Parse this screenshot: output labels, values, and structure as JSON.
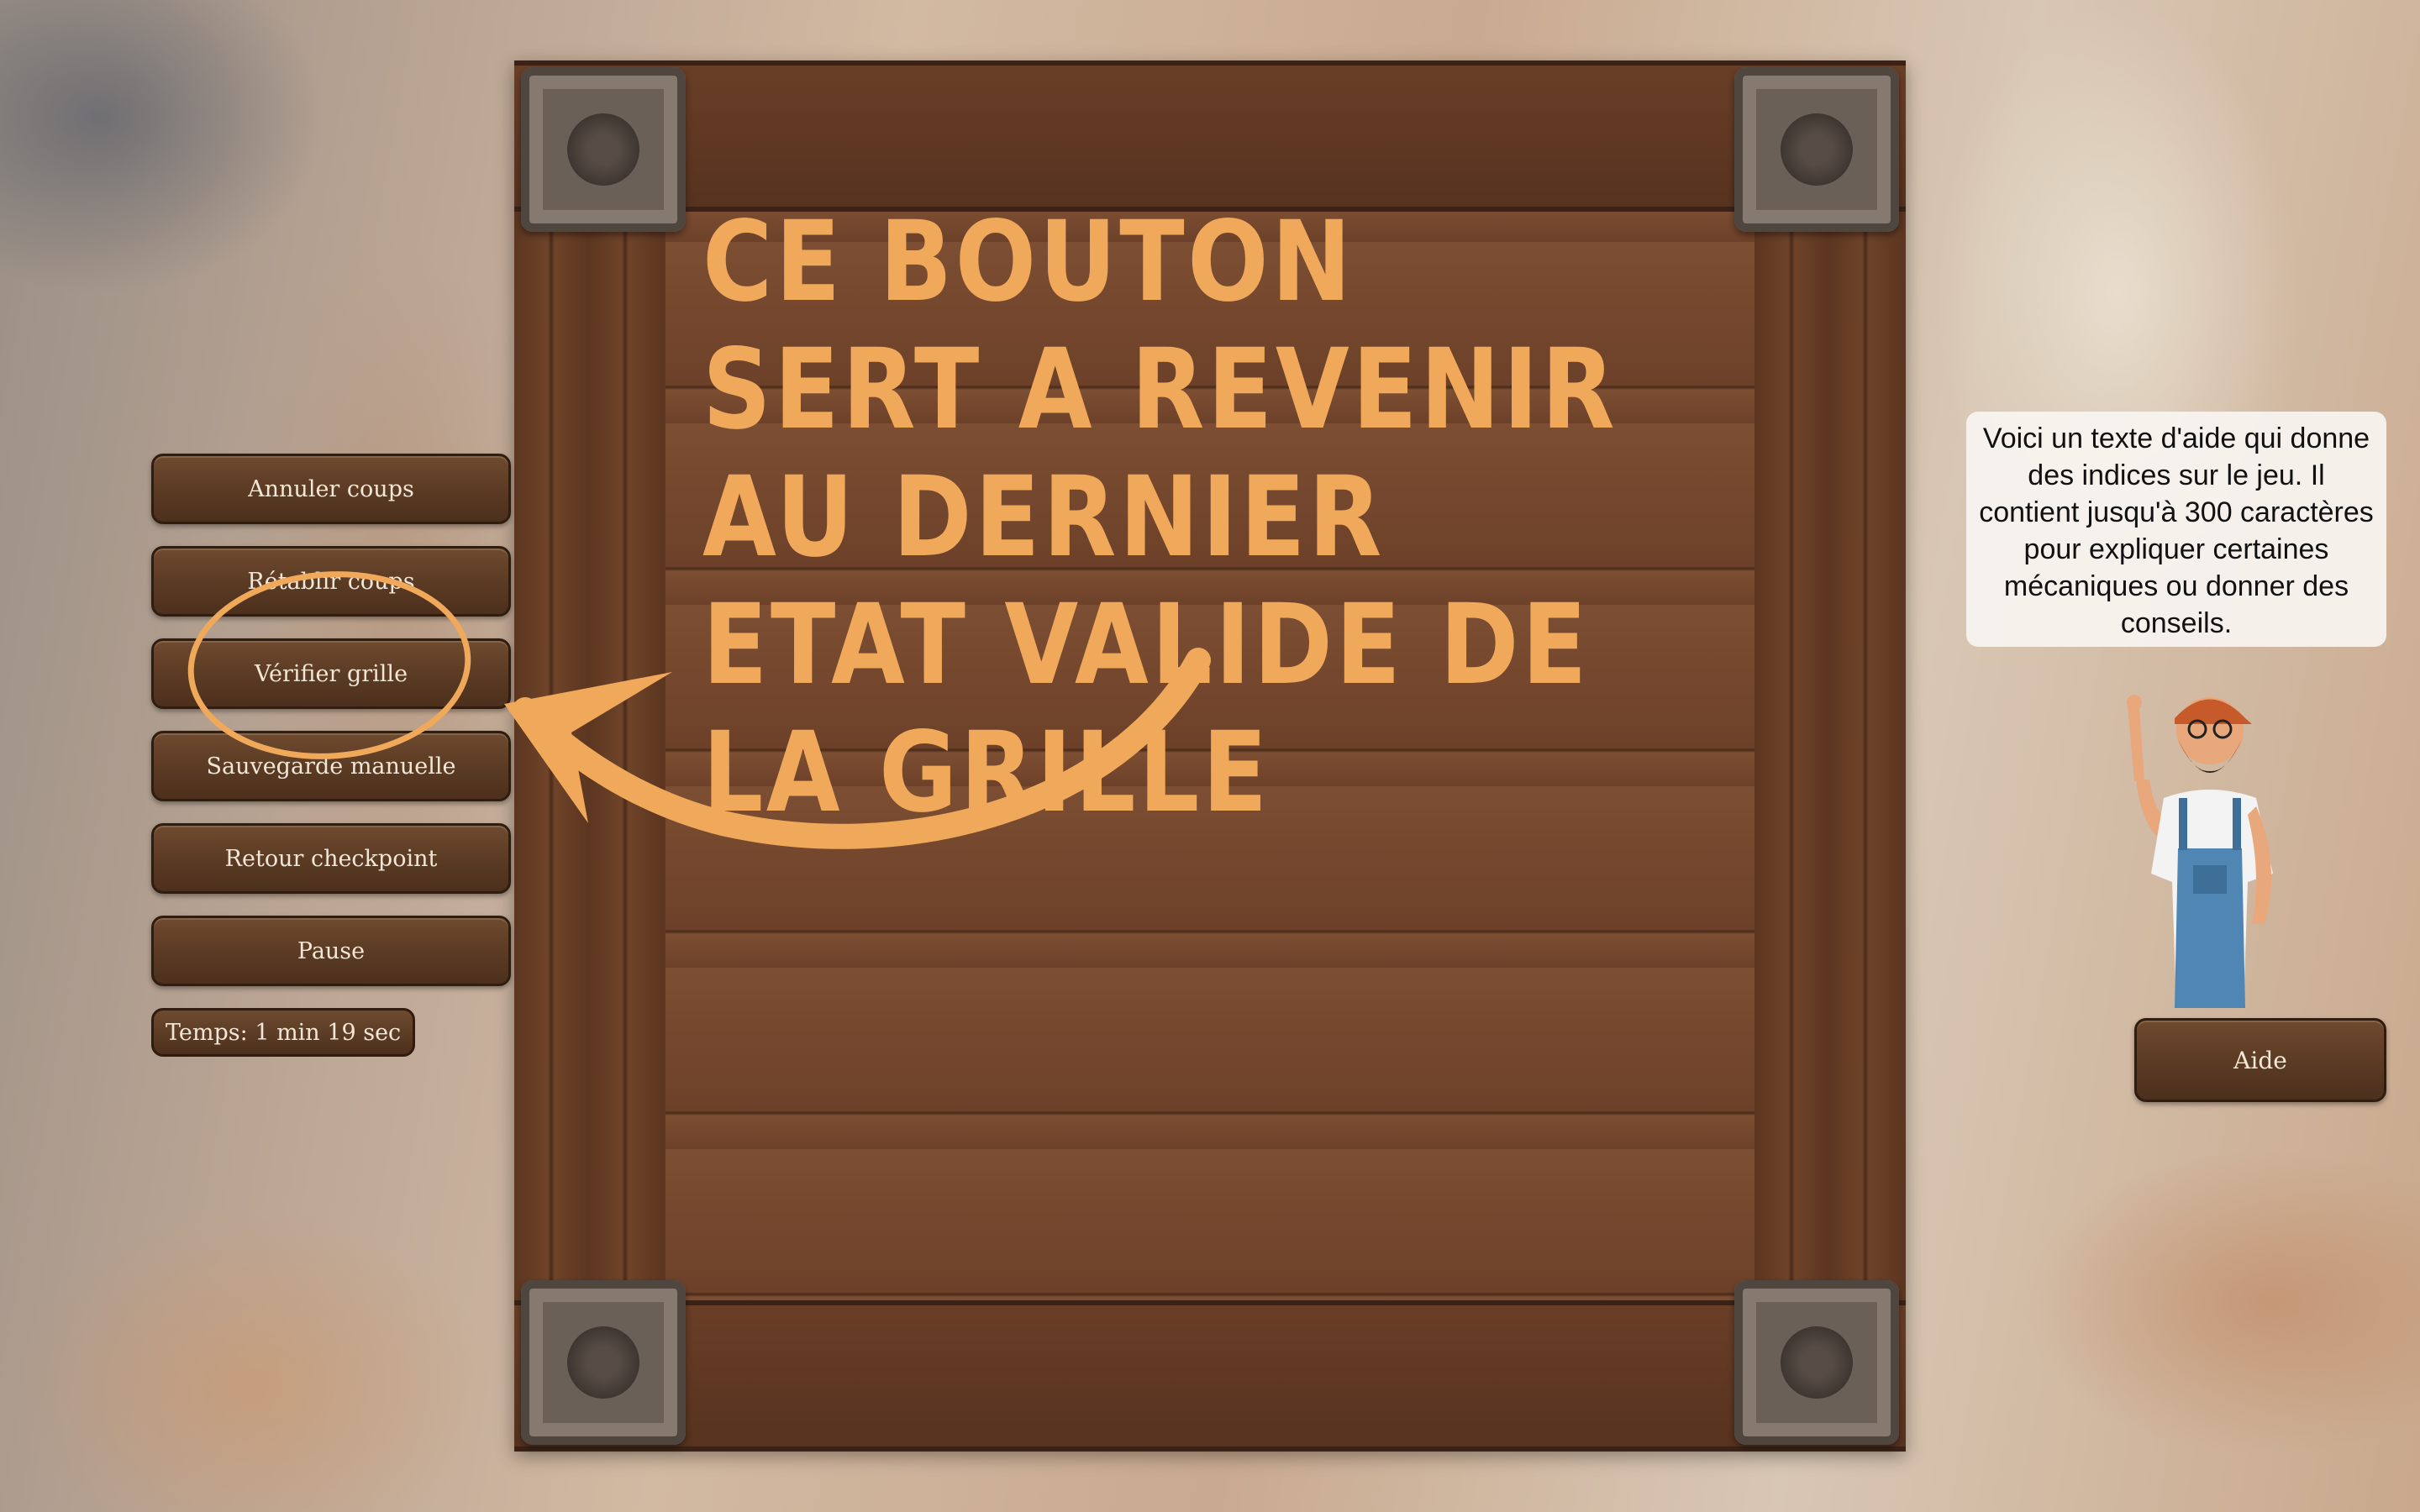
{
  "board": {
    "annotation": "CE BOUTON SERT A REVENIR AU DERNIER ETAT VALIDE DE LA GRILLE"
  },
  "menu": {
    "items": [
      {
        "label": "Annuler coups"
      },
      {
        "label": "Rétablir coups"
      },
      {
        "label": "Vérifier grille"
      },
      {
        "label": "Sauvegarde manuelle"
      },
      {
        "label": "Retour checkpoint"
      },
      {
        "label": "Pause"
      }
    ],
    "timer": "Temps: 1 min 19 sec"
  },
  "help": {
    "text": "Voici un texte d'aide qui donne des indices sur le jeu. Il contient jusqu'à 300 caractères pour expliquer certaines mécaniques ou donner des conseils.",
    "button_label": "Aide"
  },
  "colors": {
    "annotation": "#f0a95b",
    "button": "#5a3a23",
    "button_text": "#f2e6d6",
    "wood": "#6d4129"
  },
  "icons": [
    "stone-corner-ornament-icon",
    "curved-arrow-icon",
    "highlight-circle-icon"
  ]
}
